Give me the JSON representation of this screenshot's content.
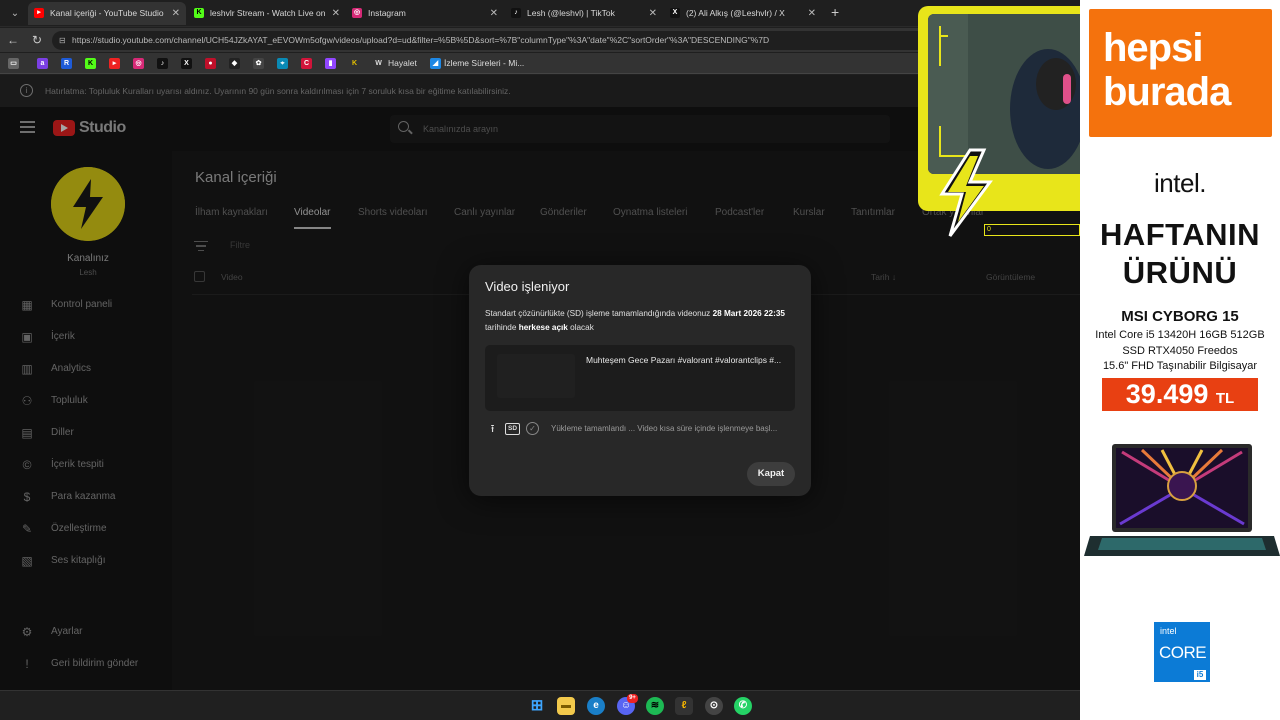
{
  "browser": {
    "tabs": [
      {
        "label": "Kanal içeriği - YouTube Studio",
        "icon": "youtube-icon",
        "color": "#ff0000"
      },
      {
        "label": "leshvlr Stream - Watch Live on Kick",
        "icon": "kick-icon",
        "color": "#53fc18"
      },
      {
        "label": "Instagram",
        "icon": "instagram-icon",
        "color": "#d62976"
      },
      {
        "label": "Lesh (@leshvl) | TikTok",
        "icon": "tiktok-icon",
        "color": "#111111"
      },
      {
        "label": "(2) Ali Alkış (@Leshvlr) / X",
        "icon": "x-icon",
        "color": "#111111"
      }
    ],
    "url": "https://studio.youtube.com/channel/UCH54JZkAYAT_eEVOWm5ofgw/videos/upload?d=ud&filter=%5B%5D&sort=%7B\"columnType\"%3A\"date\"%2C\"sortOrder\"%3A\"DESCENDING\"%7D",
    "bookmarks": [
      {
        "label": "Hayalet"
      },
      {
        "label": "İzleme Süreleri - Mi..."
      }
    ]
  },
  "notice": {
    "text": "Hatırlatma: Topluluk Kuralları uyarısı aldınız. Uyarının 90 gün sonra kaldırılması için 7 soruluk kısa bir eğitime katılabilirsiniz."
  },
  "header": {
    "logo_text": "Studio",
    "search_placeholder": "Kanalınızda arayın"
  },
  "sidebar": {
    "channel_name": "Kanalınız",
    "channel_handle": "Lesh",
    "items": [
      {
        "label": "Kontrol paneli",
        "icon": "dashboard-icon"
      },
      {
        "label": "İçerik",
        "icon": "content-icon"
      },
      {
        "label": "Analytics",
        "icon": "analytics-icon"
      },
      {
        "label": "Topluluk",
        "icon": "community-icon"
      },
      {
        "label": "Diller",
        "icon": "subtitles-icon"
      },
      {
        "label": "İçerik tespiti",
        "icon": "copyright-icon"
      },
      {
        "label": "Para kazanma",
        "icon": "monetization-icon"
      },
      {
        "label": "Özelleştirme",
        "icon": "customization-icon"
      },
      {
        "label": "Ses kitaplığı",
        "icon": "audio-library-icon"
      }
    ],
    "bottom": [
      {
        "label": "Ayarlar",
        "icon": "settings-icon"
      },
      {
        "label": "Geri bildirim gönder",
        "icon": "feedback-icon"
      }
    ]
  },
  "main": {
    "title": "Kanal içeriği",
    "tabs": [
      "İlham kaynakları",
      "Videolar",
      "Shorts videoları",
      "Canlı yayınlar",
      "Gönderiler",
      "Oynatma listeleri",
      "Podcast'ler",
      "Kurslar",
      "Tanıtımlar",
      "Ortak yayınlar"
    ],
    "active_tab": "Videolar",
    "filter_placeholder": "Filtre",
    "columns": {
      "video": "Video",
      "date": "Tarih",
      "views": "Görüntüleme"
    }
  },
  "modal": {
    "title": "Video işleniyor",
    "body_prefix": "Standart çözünürlükte (SD) işleme tamamlandığında videonuz ",
    "body_date": "28 Mart 2026 22:35",
    "body_mid": " tarihinde ",
    "body_visibility": "herkese açık",
    "body_suffix": " olacak",
    "video_title": "Muhteşem Gece Pazarı #valorant #valorantclips #...",
    "sd_label": "SD",
    "status": "Yükleme tamamlandı ... Video kısa süre içinde işlenmeye başl...",
    "close_label": "Kapat"
  },
  "overlay": {
    "counter": "0"
  },
  "ad": {
    "brand_line1": "hepsi",
    "brand_line2": "burada",
    "intel": "intel.",
    "headline1": "HAFTANIN",
    "headline2": "ÜRÜNÜ",
    "product": "MSI CYBORG 15",
    "spec1": "Intel Core i5 13420H 16GB 512GB",
    "spec2": "SSD RTX4050 Freedos",
    "spec3": "15.6\" FHD Taşınabilir Bilgisayar",
    "price": "39.499",
    "currency": "TL",
    "badge_intel": "intel",
    "badge_core": "CORE",
    "badge_i5": "i5",
    "brand_color": "#f4720d",
    "price_color": "#e84012"
  },
  "taskbar": {
    "apps": [
      "windows-start-icon",
      "file-explorer-icon",
      "edge-icon",
      "discord-icon",
      "spotify-icon",
      "app-icon",
      "steam-icon",
      "whatsapp-icon"
    ],
    "discord_badge": "9+"
  }
}
